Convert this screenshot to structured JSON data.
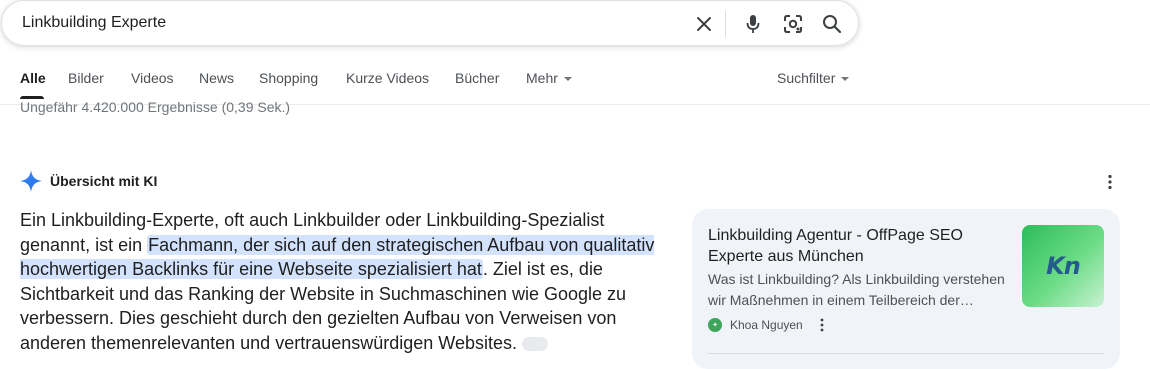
{
  "search": {
    "query": "Linkbuilding Experte"
  },
  "icons": {
    "clear": "close-icon",
    "voice": "microphone-icon",
    "lens": "camera-lens-icon",
    "search": "search-icon"
  },
  "tabs": [
    {
      "label": "Alle",
      "active": true
    },
    {
      "label": "Bilder"
    },
    {
      "label": "Videos"
    },
    {
      "label": "News"
    },
    {
      "label": "Shopping"
    },
    {
      "label": "Kurze Videos"
    },
    {
      "label": "Bücher"
    },
    {
      "label": "Mehr"
    }
  ],
  "filter_label": "Suchfilter",
  "results_stats": "Ungefähr 4.420.000 Ergebnisse (0,39 Sek.)",
  "ai_overview": {
    "label": "Übersicht mit KI",
    "text_before": "Ein Linkbuilding-Experte, oft auch Linkbuilder oder Linkbuilding-Spezialist genannt, ist ein ",
    "text_highlight": "Fachmann, der sich auf den strategischen Aufbau von qualitativ hochwertigen Backlinks für eine Webseite spezialisiert hat",
    "text_after": ". Ziel ist es, die Sichtbarkeit und das Ranking der Website in Suchmaschinen wie Google zu verbessern. Dies geschieht durch den gezielten Aufbau von Verweisen von anderen themenrelevanten und vertrauenswürdigen Websites."
  },
  "source_card": {
    "title": "Linkbuilding Agentur - OffPage SEO Experte aus München",
    "snippet": "Was ist Linkbuilding? Als Linkbuilding verstehen wir Maßnehmen in einem Teilbereich der…",
    "thumb_text": "Kn",
    "source_name": "Khoa Nguyen"
  },
  "colors": {
    "accent": "#1a73e8",
    "highlight": "#d3e3fd",
    "card_bg": "#f0f4f9"
  }
}
